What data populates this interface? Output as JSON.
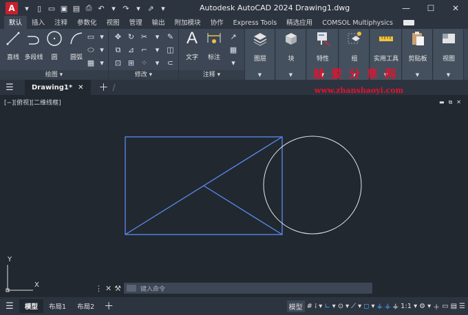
{
  "app": {
    "logo_letter": "A",
    "title": "Autodesk AutoCAD 2024    Drawing1.dwg"
  },
  "ribbon_tabs": [
    "默认",
    "插入",
    "注释",
    "参数化",
    "视图",
    "管理",
    "输出",
    "附加模块",
    "协作",
    "Express Tools",
    "精选应用",
    "COMSOL Multiphysics"
  ],
  "ribbon": {
    "draw": {
      "line": "直线",
      "polyline": "多段线",
      "circle": "圆",
      "arc": "圆弧",
      "footer": "绘图 ▾"
    },
    "modify": {
      "footer": "修改 ▾"
    },
    "annotation": {
      "text": "文字",
      "dimension": "标注",
      "footer": "注释 ▾"
    },
    "layers": "图层",
    "block": "块",
    "properties": "特性",
    "groups": "组",
    "utilities": "实用工具",
    "clipboard": "剪贴板",
    "view": "视图"
  },
  "watermark": {
    "title": "就爱分享网",
    "url": "www.zhanshaoyi.com"
  },
  "document_tab": {
    "label": "Drawing1*"
  },
  "viewport_label": "[−][俯视][二维线框]",
  "ucs": {
    "x": "X",
    "y": "Y"
  },
  "command_line": {
    "placeholder": "键入命令"
  },
  "layout_tabs": [
    "模型",
    "布局1",
    "布局2"
  ],
  "status": {
    "model": "模型",
    "scale": "1:1"
  },
  "colors": {
    "background": "#212830",
    "panel": "#3c4654",
    "rectangle_lines": "#5b8cf0",
    "circle_line": "#e8e8e8",
    "watermark": "#e8102c"
  }
}
